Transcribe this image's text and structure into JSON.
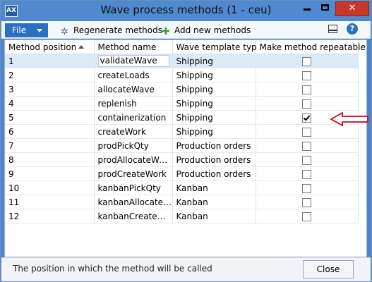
{
  "window": {
    "title": "Wave process methods (1 - ceu)",
    "app_icon_text": "AX"
  },
  "toolbar": {
    "file_label": "File",
    "regenerate_label": "Regenerate methods",
    "add_label": "Add new methods"
  },
  "grid": {
    "columns": [
      "Method position",
      "Method name",
      "Wave template type",
      "Make method repeatable"
    ],
    "sort_column": "Method position",
    "sort_direction": "ascending",
    "rows": [
      {
        "position": "1",
        "name": "validateWave",
        "type": "Shipping",
        "repeatable": false,
        "selected": true
      },
      {
        "position": "2",
        "name": "createLoads",
        "type": "Shipping",
        "repeatable": false
      },
      {
        "position": "3",
        "name": "allocateWave",
        "type": "Shipping",
        "repeatable": false
      },
      {
        "position": "4",
        "name": "replenish",
        "type": "Shipping",
        "repeatable": false
      },
      {
        "position": "5",
        "name": "containerization",
        "type": "Shipping",
        "repeatable": true
      },
      {
        "position": "6",
        "name": "createWork",
        "type": "Shipping",
        "repeatable": false
      },
      {
        "position": "7",
        "name": "prodPickQty",
        "type": "Production orders",
        "repeatable": false
      },
      {
        "position": "8",
        "name": "prodAllocateWave",
        "type": "Production orders",
        "repeatable": false
      },
      {
        "position": "9",
        "name": "prodCreateWork",
        "type": "Production orders",
        "repeatable": false
      },
      {
        "position": "10",
        "name": "kanbanPickQty",
        "type": "Kanban",
        "repeatable": false
      },
      {
        "position": "11",
        "name": "kanbanAllocateW...",
        "type": "Kanban",
        "repeatable": false
      },
      {
        "position": "12",
        "name": "kanbanCreateWork",
        "type": "Kanban",
        "repeatable": false
      }
    ]
  },
  "status": {
    "text": "The position in which the method will be called",
    "close_label": "Close"
  },
  "colors": {
    "titlebar": "#4f8ad0",
    "file_button": "#2b6fc2",
    "close_window": "#c7382b",
    "selected_row": "#dceaf8",
    "annotation_arrow": "#d0021b"
  }
}
